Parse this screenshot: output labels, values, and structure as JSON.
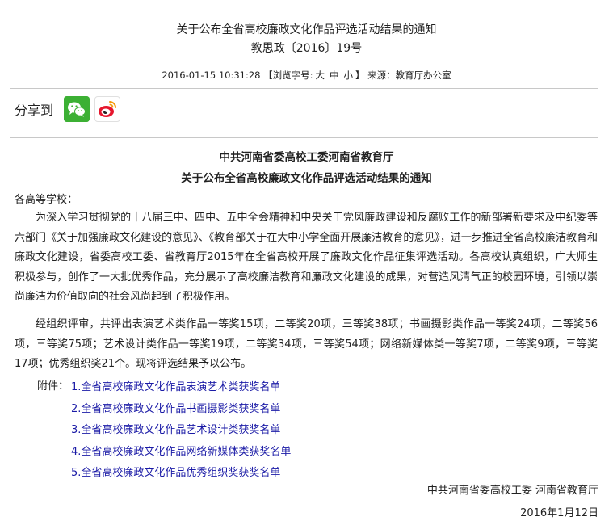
{
  "header": {
    "title_line1": "关于公布全省高校廉政文化作品评选活动结果的通知",
    "title_line2": "教思政〔2016〕19号",
    "meta_datetime": "2016-01-15 10:31:28",
    "meta_fontsize_label": "【浏览字号:",
    "meta_fontsize_large": "大",
    "meta_fontsize_medium": "中",
    "meta_fontsize_small": "小",
    "meta_fontsize_close": "】",
    "meta_source": "来源：教育厅办公室"
  },
  "share": {
    "label": "分享到",
    "wechat_icon": "wechat-icon",
    "weibo_icon": "weibo-icon",
    "wechat_color": "#3cb034",
    "weibo_color": "#e6162d"
  },
  "article": {
    "org_title": "中共河南省委高校工委河南省教育厅",
    "notice_title": "关于公布全省高校廉政文化作品评选活动结果的通知",
    "salutation": "各高等学校：",
    "paragraph1": "为深入学习贯彻党的十八届三中、四中、五中全会精神和中央关于党风廉政建设和反腐败工作的新部署新要求及中纪委等六部门《关于加强廉政文化建设的意见》、《教育部关于在大中小学全面开展廉洁教育的意见》，进一步推进全省高校廉洁教育和廉政文化建设，省委高校工委、省教育厅2015年在全省高校开展了廉政文化作品征集评选活动。各高校认真组织，广大师生积极参与，创作了一大批优秀作品，充分展示了高校廉洁教育和廉政文化建设的成果，对营造风清气正的校园环境，引领以崇尚廉洁为价值取向的社会风尚起到了积极作用。",
    "paragraph2": "经组织评审，共评出表演艺术类作品一等奖15项，二等奖20项，三等奖38项；书画摄影类作品一等奖24项，二等奖56项，三等奖75项；艺术设计类作品一等奖19项，二等奖34项，三等奖54项；网络新媒体类一等奖7项，二等奖9项，三等奖17项；优秀组织奖21个。现将评选结果予以公布。",
    "attachments_label": "附件：",
    "attachments": [
      "1.全省高校廉政文化作品表演艺术类获奖名单",
      "2.全省高校廉政文化作品书画摄影类获奖名单",
      "3.全省高校廉政文化作品艺术设计类获奖名单",
      "4.全省高校廉政文化作品网络新媒体类获奖名单",
      "5.全省高校廉政文化作品优秀组织奖获奖名单"
    ],
    "link_color": "#1a1aa6",
    "signature_org": "中共河南省委高校工委 河南省教育厅",
    "signature_date": "2016年1月12日"
  }
}
